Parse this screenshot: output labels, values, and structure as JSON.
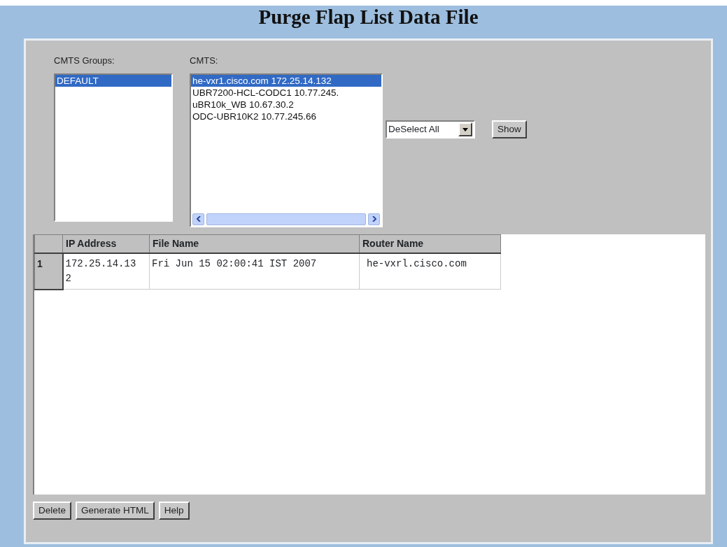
{
  "title": "Purge Flap List Data File",
  "groups": {
    "label": "CMTS Groups:",
    "items": [
      {
        "text": "DEFAULT",
        "selected": true
      }
    ]
  },
  "cmts": {
    "label": "CMTS:",
    "items": [
      {
        "text": "he-vxr1.cisco.com 172.25.14.132",
        "selected": true
      },
      {
        "text": "UBR7200-HCL-CODC1 10.77.245.",
        "selected": false
      },
      {
        "text": "uBR10k_WB 10.67.30.2",
        "selected": false
      },
      {
        "text": "ODC-UBR10K2 10.77.245.66",
        "selected": false
      }
    ]
  },
  "selection_dropdown": {
    "value": "DeSelect All"
  },
  "show_button": "Show",
  "table": {
    "columns": [
      "IP Address",
      "File Name",
      "Router Name"
    ],
    "rows": [
      {
        "number": "1",
        "cells": [
          "172.25.14.132",
          "Fri Jun 15 02:00:41 IST 2007",
          "he-vxrl.cisco.com"
        ]
      }
    ]
  },
  "buttons": [
    "Delete",
    "Generate HTML",
    "Help"
  ]
}
